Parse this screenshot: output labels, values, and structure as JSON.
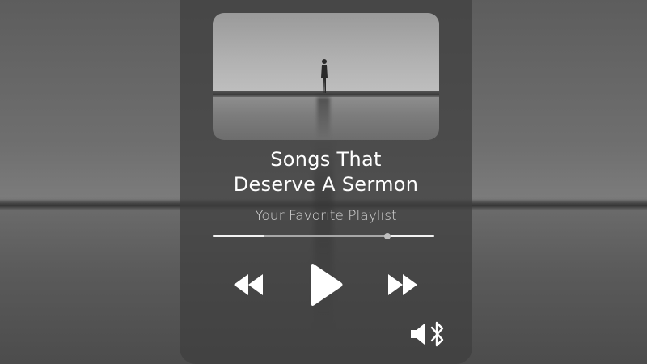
{
  "background": {
    "icon": "horizon-landscape",
    "tone": "#6f6f6f"
  },
  "player": {
    "artwork_icon": "person-standing-on-shore-photo",
    "title_line1": "Songs That",
    "title_line2": "Deserve A Sermon",
    "subtitle": "Your Favorite Playlist",
    "progress": {
      "played_fraction": 0.79,
      "buffer_fraction": 0.23
    },
    "controls": {
      "rewind_icon": "rewind-icon",
      "play_icon": "play-icon",
      "forward_icon": "fast-forward-icon",
      "volume_icon": "volume-icon",
      "bluetooth_icon": "bluetooth-icon"
    },
    "colors": {
      "card": "#3e3e3e",
      "text": "#ffffff",
      "subtitle": "#d6d6d6",
      "track": "#f2f2f2",
      "thumb": "#bfbfbf"
    }
  }
}
